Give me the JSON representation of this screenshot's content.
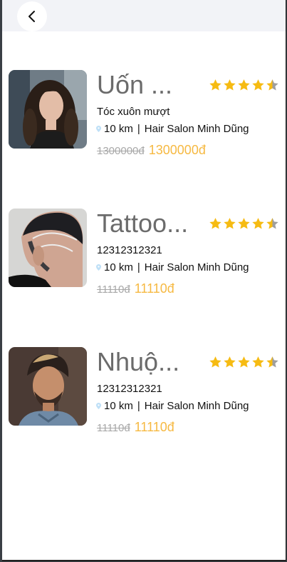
{
  "colors": {
    "accent": "#f6b942",
    "star": "#f6bb12",
    "star_empty": "#9e9e9e",
    "topbar": "#f2f3f7"
  },
  "header": {
    "back_icon": "chevron-left-icon"
  },
  "services": [
    {
      "title": "Uốn ...",
      "rating": 4.5,
      "description": "Tóc xuôn mượt",
      "distance": "10 km",
      "separator": "|",
      "salon": "Hair Salon Minh Dũng",
      "old_price": "1300000đ",
      "new_price": "1300000đ"
    },
    {
      "title": "Tattoo...",
      "rating": 4.5,
      "description": "12312312321",
      "distance": "10 km",
      "separator": "|",
      "salon": "Hair Salon Minh Dũng",
      "old_price": "11110đ",
      "new_price": "11110đ"
    },
    {
      "title": "Nhuộ...",
      "rating": 4.5,
      "description": "12312312321",
      "distance": "10 km",
      "separator": "|",
      "salon": "Hair Salon Minh Dũng",
      "old_price": "11110đ",
      "new_price": "11110đ"
    }
  ]
}
